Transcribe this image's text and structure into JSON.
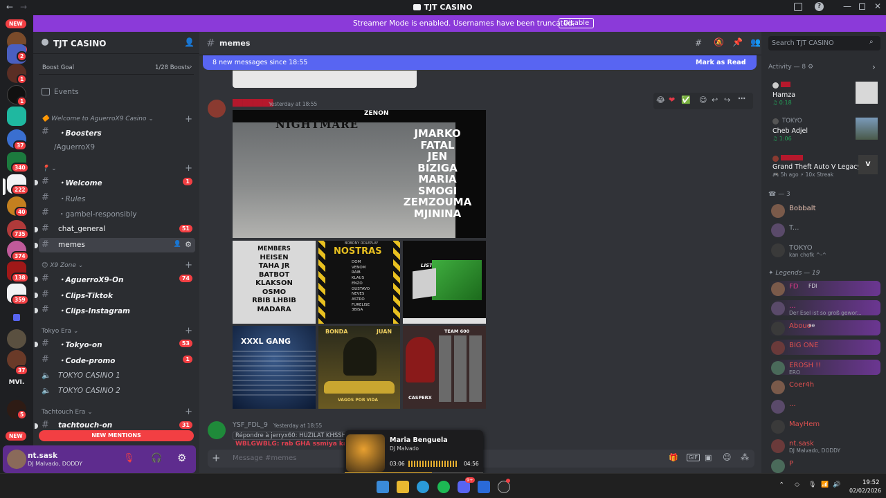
{
  "window": {
    "title": "TJT CASINO"
  },
  "banner": {
    "text": "Streamer Mode is enabled. Usernames have been truncated.",
    "button": "Disable"
  },
  "rail": {
    "new_top": "NEW",
    "badges": [
      "20",
      "2",
      "1",
      "1",
      "37",
      "340",
      "222",
      "40",
      "735",
      "374",
      "138",
      "359",
      "37",
      "5"
    ],
    "new_bottom": "NEW"
  },
  "sidebar": {
    "server_name": "TJT CASINO",
    "boost_goal": "Boost Goal",
    "boost_count": "1/28 Boosts",
    "events": "Events",
    "categories": [
      "Welcome to AguerroX9 Casino",
      "X9 Zone",
      "Tokyo Era",
      "Tachtouch Era"
    ],
    "channels": [
      {
        "name": "・Boosters"
      },
      {
        "name": "/AguerroX9"
      },
      {
        "name": "・Welcome",
        "count": "1"
      },
      {
        "name": "・Rules"
      },
      {
        "name": "・gambel-responsibly"
      },
      {
        "name": "chat_general",
        "count": "51"
      },
      {
        "name": "memes"
      },
      {
        "name": "・AguerroX9-On",
        "count": "74"
      },
      {
        "name": "・Clips-Tiktok"
      },
      {
        "name": "・Clips-Instagram"
      },
      {
        "name": "・Tokyo-on",
        "count": "53"
      },
      {
        "name": "・Code-promo",
        "count": "1"
      },
      {
        "name": "TOKYO CASINO 1"
      },
      {
        "name": "TOKYO CASINO 2"
      },
      {
        "name": "tachtouch-on",
        "count": "31"
      }
    ],
    "new_mentions": "NEW MENTIONS"
  },
  "user": {
    "name": "nt.sask",
    "status": "DJ Malvado, DODDY"
  },
  "chat": {
    "channel": "memes",
    "new_messages": "8 new messages since 18:55",
    "mark_read": "Mark as Read",
    "msg1_time": "Yesterday at 18:55",
    "img1_text": {
      "top1": "ZENON",
      "title": "NIGHTMARE",
      "names": [
        "JMARKO",
        "FATAL",
        "JEN",
        "BIZIGA",
        "MARIA",
        "SMOGI",
        "ZEMZOUMA",
        "MJININA"
      ]
    },
    "grid_texts": {
      "members": [
        "MEMBERS",
        "HEISEN",
        "TAHA JR",
        "BATBOT",
        "KLAKSON",
        "OSMO",
        "RBIB LHBIB",
        "MADARA"
      ],
      "nostras": "NOSTRAS",
      "nostras_sub": "BOBONY ROLEPLAY",
      "nostras_list": [
        "DOM",
        "VENOM",
        "RAIB",
        "KLAUS",
        "ENZO",
        "GUSTAVO",
        "NEVES",
        "ASTRO",
        "FURELISE",
        "3BISA"
      ],
      "liste": "LISTE GANG",
      "xxxl": "XXXL GANG",
      "bonda": "BONDA",
      "juan": "JUAN",
      "vagos": "VAGOS POR VIDA",
      "team": "TEAM 600",
      "casper": "CASPERX"
    },
    "msg2_author": "YSF_FDL_9",
    "msg2_time": "Yesterday at 18:55",
    "msg2_reply": "Répondre à jerryx60: HUZILAT KHSSH",
    "msg2_text": "WBLGWBLG: rab GHA ssmiya kata",
    "composer_placeholder": "Message #memes"
  },
  "player": {
    "title": "Maria Benguela",
    "artist": "DJ Malvado",
    "elapsed": "03:06",
    "total": "04:56",
    "progress": 0.63
  },
  "members": {
    "search_placeholder": "Search TJT CASINO",
    "activity": "Activity — 8",
    "activities": [
      {
        "name": "Hamza",
        "detail": "0:18"
      },
      {
        "user": "TOKYO",
        "name": "Cheb Adjel",
        "detail": "1:06"
      },
      {
        "name": "Grand Theft Auto V Legacy",
        "detail": "5h ago",
        "streak": "10x Streak"
      }
    ],
    "group1": "— 3",
    "group1_members": [
      {
        "name": "Bobbalt",
        "color": "#e6c0b0"
      },
      {
        "name": "T...",
        "color": "#949ba4"
      },
      {
        "name": "TOKYO",
        "status": "kan chofk ^-^",
        "color": "#949ba4"
      }
    ],
    "group2": "Legends — 19",
    "group2_members": [
      {
        "name": "FD",
        "tag": "FDI",
        "color": "#e03a8a"
      },
      {
        "name": "...",
        "status": "Der Esel ist so groß gewor...",
        "color": "#e03a8a"
      },
      {
        "name": "Abouo",
        "tag": "ee",
        "color": "#e05050"
      },
      {
        "name": "BIG ONE",
        "color": "#e05050"
      },
      {
        "name": "EROSH !!",
        "status": "ERO",
        "color": "#e05050"
      },
      {
        "name": "Coer4h",
        "color": "#e05050"
      },
      {
        "name": "...",
        "color": "#e05050"
      },
      {
        "name": "MayHem",
        "color": "#e05050"
      },
      {
        "name": "nt.sask",
        "status": "DJ Malvado, DODDY",
        "color": "#e05050"
      },
      {
        "name": "P",
        "color": "#e05050"
      }
    ]
  },
  "taskbar": {
    "time": "19:52",
    "date": "02/02/2026",
    "discord_badge": "9+"
  }
}
